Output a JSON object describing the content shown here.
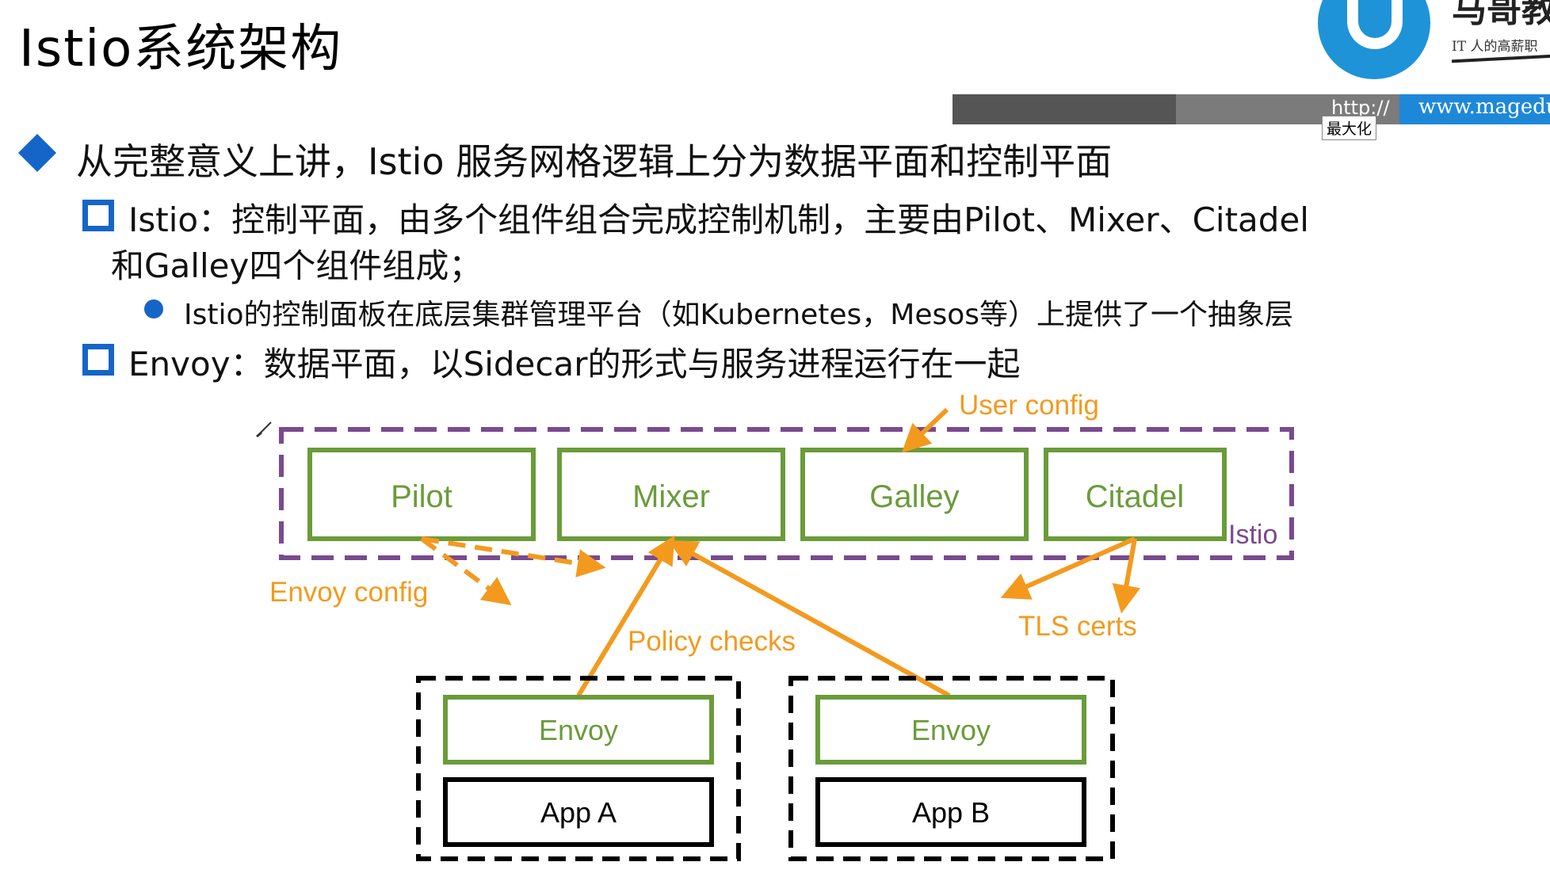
{
  "title": "Istio系统架构",
  "logo": {
    "brand": "马哥教",
    "slogan": "IT 人的高薪职"
  },
  "topbar": {
    "http": "http://",
    "url": "www.magedu.",
    "tooltip": "最大化"
  },
  "bullets": {
    "level1": "从完整意义上讲，Istio 服务网格逻辑上分为数据平面和控制平面",
    "istio_line1": "Istio：控制平面，由多个组件组合完成控制机制，主要由Pilot、Mixer、Citadel",
    "istio_line2": "和Galley四个组件组成；",
    "istio_sub": "Istio的控制面板在底层集群管理平台（如Kubernetes，Mesos等）上提供了一个抽象层",
    "envoy": "Envoy：数据平面，以Sidecar的形式与服务进程运行在一起"
  },
  "diagram": {
    "components": [
      "Pilot",
      "Mixer",
      "Galley",
      "Citadel"
    ],
    "istio_label": "Istio",
    "user_config": "User config",
    "envoy_config": "Envoy config",
    "policy_checks": "Policy checks",
    "tls_certs": "TLS certs",
    "pods": [
      {
        "proxy": "Envoy",
        "app": "App A"
      },
      {
        "proxy": "Envoy",
        "app": "App B"
      }
    ]
  },
  "colors": {
    "accent_blue": "#1565c8",
    "component_green": "#6a9c3a",
    "arrow_orange": "#f39a1e",
    "istio_purple": "#7a4a8e"
  }
}
